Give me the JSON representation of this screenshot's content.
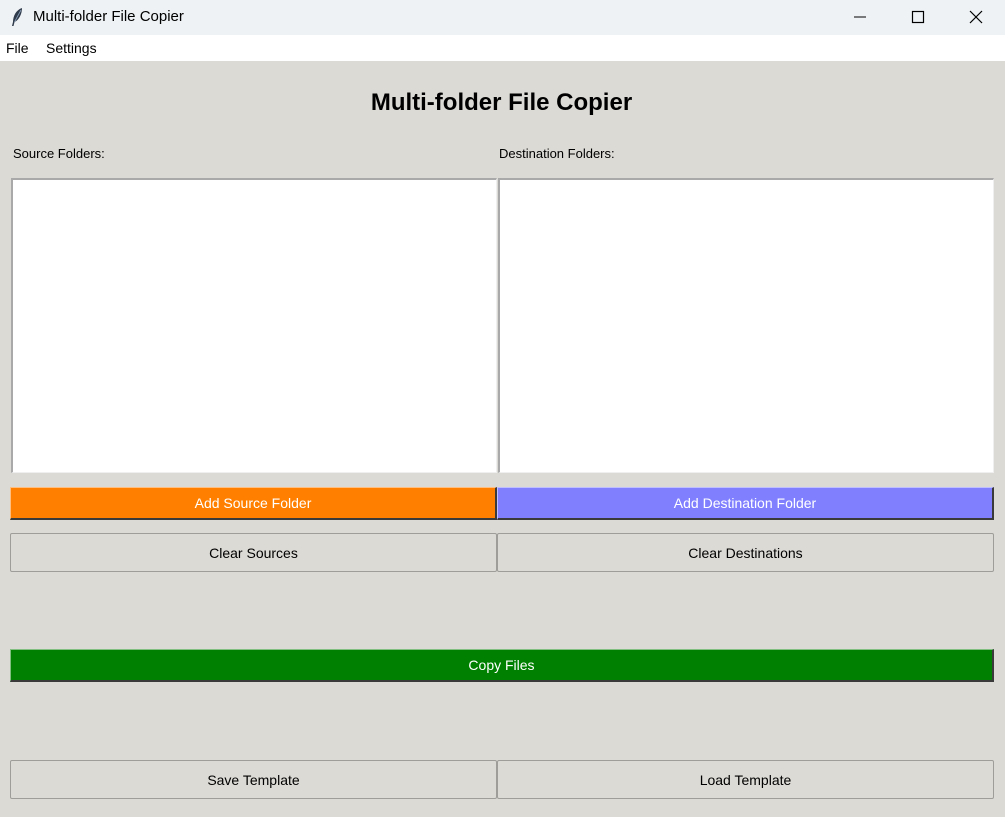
{
  "window": {
    "title": "Multi-folder File Copier",
    "icon": "feather-icon",
    "controls": [
      "minimize-icon",
      "maximize-icon",
      "close-icon"
    ]
  },
  "menu": {
    "file": "File",
    "settings": "Settings"
  },
  "main": {
    "heading": "Multi-folder File Copier",
    "source_label": "Source Folders:",
    "destination_label": "Destination Folders:",
    "source_items": [],
    "destination_items": []
  },
  "buttons": {
    "add_source": "Add Source Folder",
    "add_destination": "Add Destination Folder",
    "clear_sources": "Clear Sources",
    "clear_destinations": "Clear Destinations",
    "copy_files": "Copy Files",
    "save_template": "Save Template",
    "load_template": "Load Template"
  },
  "colors": {
    "add_source": "#ff8000",
    "add_destination": "#8080ff",
    "copy_files": "#008000",
    "background": "#dcdad5"
  }
}
